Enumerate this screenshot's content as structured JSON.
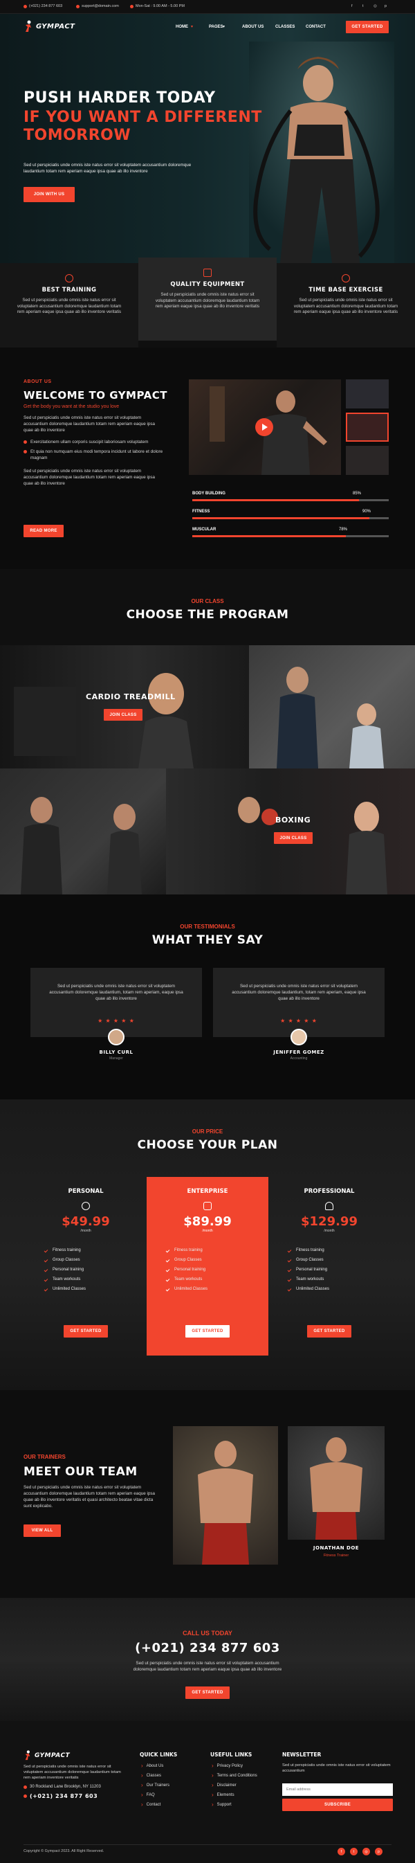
{
  "topbar": {
    "phone": "(+021) 234 877 603",
    "email": "support@domain.com",
    "hours": "Mon-Sat : 9.00 AM - 5.00 PM",
    "social": [
      "f",
      "t",
      "◎",
      "p"
    ]
  },
  "nav": {
    "brand": "GYMPACT",
    "items": [
      "HOME",
      "PAGES",
      "ABOUT US",
      "CLASSES",
      "CONTACT"
    ],
    "cta": "GET STARTED"
  },
  "hero": {
    "line1": "PUSH HARDER TODAY",
    "line2": "IF YOU WANT A DIFFERENT",
    "line3": "TOMORROW",
    "text": "Sed ut perspiciatis unde omnis iste natus error sit voluptatem accusantium doloremque laudantium totam rem aperiam eaque ipsa quae ab illo inventore",
    "cta": "JOIN WITH US"
  },
  "features": [
    {
      "title": "BEST TRAINING",
      "text": "Sed ut perspiciatis unde omnis iste natus error sit voluptatem accusantium doloremque laudantium totam rem aperiam eaque ipsa quae ab illo inventore veritatis"
    },
    {
      "title": "QUALITY EQUIPMENT",
      "text": "Sed ut perspiciatis unde omnis iste natus error sit voluptatem accusantium doloremque laudantium totam rem aperiam eaque ipsa quae ab illo inventore veritatis"
    },
    {
      "title": "TIME BASE EXERCISE",
      "text": "Sed ut perspiciatis unde omnis iste natus error sit voluptatem accusantium doloremque laudantium totam rem aperiam eaque ipsa quae ab illo inventore veritatis"
    }
  ],
  "about": {
    "kicker": "ABOUT US",
    "title": "WELCOME TO GYMPACT",
    "subtitle": "Get the body you want at the studio you love",
    "text1": "Sed ut perspiciatis unde omnis iste natus error sit voluptatem accusantium doloremque laudantium totam rem aperiam eaque ipsa quae ab illo inventore",
    "bullet1": "Exercitationem ullam corporis suscipit laboriosam voluptatem",
    "bullet2": "Et quia non numquam eius modi tempora incidunt ut labore et dolore magnam",
    "text2": "Sed ut perspiciatis unde omnis iste natus error sit voluptatem accusantium doloremque laudantium totam rem aperiam eaque ipsa quae ab illo inventore",
    "cta": "READ MORE",
    "skills": [
      {
        "name": "BODY BUILDING",
        "value": 85,
        "label": "85%"
      },
      {
        "name": "FITNESS",
        "value": 90,
        "label": "90%"
      },
      {
        "name": "MUSCULAR",
        "value": 78,
        "label": "78%"
      }
    ]
  },
  "program": {
    "kicker": "OUR CLASS",
    "title": "CHOOSE THE PROGRAM",
    "class1": "CARDIO TREADMILL",
    "class2": "BOXING",
    "cta": "JOIN CLASS"
  },
  "testimonials": {
    "kicker": "OUR TESTIMONIALS",
    "title": "WHAT THEY SAY",
    "items": [
      {
        "text": "Sed ut perspiciatis unde omnis iste natus error sit voluptatem accusantium doloremque laudantium, totam rem aperiam, eaque ipsa quae ab illo inventore",
        "name": "BILLY CURL",
        "role": "Manager",
        "stars": "★ ★ ★ ★ ★"
      },
      {
        "text": "Sed ut perspiciatis unde omnis iste natus error sit voluptatem accusantium doloremque laudantium, totam rem aperiam, eaque ipsa quae ab illo inventore",
        "name": "JENIFFER GOMEZ",
        "role": "Accounting",
        "stars": "★ ★ ★ ★ ★"
      }
    ]
  },
  "pricing": {
    "kicker": "OUR PRICE",
    "title": "CHOOSE YOUR PLAN",
    "features": [
      "Fitness training",
      "Group Classes",
      "Personal training",
      "Team workouts",
      "Unlimited Classes"
    ],
    "cta": "GET STARTED",
    "plans": [
      {
        "name": "PERSONAL",
        "price": "$49.99",
        "period": "/month"
      },
      {
        "name": "ENTERPRISE",
        "price": "$89.99",
        "period": "/month"
      },
      {
        "name": "PROFESSIONAL",
        "price": "$129.99",
        "period": "/month"
      }
    ]
  },
  "team": {
    "kicker": "OUR TRAINERS",
    "title": "MEET OUR TEAM",
    "text": "Sed ut perspiciatis unde omnis iste natus error sit voluptatem accusantium doloremque laudantium totam rem aperiam eaque ipsa quae ab illo inventore veritatis et quasi architecto beatae vitae dicta sunt explicabo.",
    "cta": "VIEW ALL",
    "member_name": "JONATHAN DOE",
    "member_role": "Fitness Trainer"
  },
  "call": {
    "kicker": "CALL US TODAY",
    "phone": "(+021) 234 877 603",
    "text": "Sed ut perspiciatis unde omnis iste natus error sit voluptatem accusantium doloremque laudantium totam rem aperiam eaque ipsa quae ab illo inventore",
    "cta": "GET STARTED"
  },
  "footer": {
    "brand": "GYMPACT",
    "text": "Sed ut perspiciatis unde omnis iste natus error sit voluptatem accusantium doloremque laudantium totam rem aperiam inventore veritatis",
    "address": "30 Rockland Lane Brooklyn, NY 11203",
    "phone": "(+021) 234 877 603",
    "quick_title": "QUICK LINKS",
    "quick": [
      "About Us",
      "Classes",
      "Our Trainers",
      "FAQ",
      "Contact"
    ],
    "useful_title": "USEFUL LINKS",
    "useful": [
      "Privacy Policy",
      "Terms and Conditions",
      "Disclaimer",
      "Elements",
      "Support"
    ],
    "news_title": "NEWSLETTER",
    "news_text": "Sed ut perspiciatis unde omnis iste natus error sit voluptatem accusantium",
    "email_placeholder": "Email address",
    "subscribe": "SUBSCRIBE",
    "copyright": "Copyright © Gympact 2023. All Right Reserved.",
    "social": [
      "f",
      "t",
      "◎",
      "p"
    ]
  }
}
